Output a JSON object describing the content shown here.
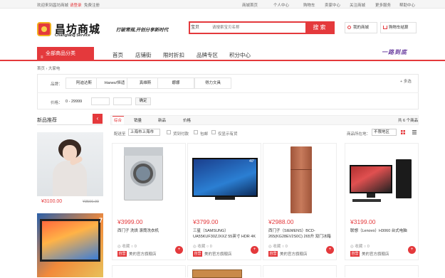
{
  "topbar": {
    "welcome": "欢迎来到昌坊商城",
    "login": "请登录",
    "register": "免费注册",
    "links": [
      "商城首页",
      "个人中心",
      "购物车",
      "卖家中心",
      "关注商城",
      "更多服务",
      "帮助中心"
    ]
  },
  "header": {
    "logo_cn": "昌坊商城",
    "logo_en": "Changfang Service",
    "slogan": "打破常规,开创分享新时代",
    "search_category": "宝贝",
    "search_placeholder": "请搜索宝贝名称",
    "search_button": "搜索",
    "my_mall": "我的商城",
    "cart": "购物车结算"
  },
  "nav": {
    "all_categories": "全部商品分类",
    "items": [
      "首页",
      "店铺街",
      "限时折扣",
      "品牌专区",
      "积分中心"
    ],
    "promo": "一路到底"
  },
  "breadcrumb": "首页 › 大家电",
  "filter": {
    "brand_label": "品牌：",
    "brands": [
      "阿迪达斯",
      "Hanes/恒适",
      "真维斯",
      "娜娜",
      "得力文具"
    ],
    "more": "多选",
    "price_label": "价格：",
    "price_range": "0 - 29999",
    "price_ok": "确定"
  },
  "sidebar": {
    "title": "新品推荐",
    "arrow": "‹",
    "price": "¥3100.00",
    "old_price": "¥3500.00",
    "label2": "7"
  },
  "sort": {
    "items": [
      "综合",
      "销量",
      "新品",
      "价格"
    ],
    "total": "共 6 个商品"
  },
  "options": {
    "ship_label": "配送至",
    "ship_value": "上海市上海市",
    "checks": [
      "货到付款",
      "包邮",
      "仅显示有货"
    ],
    "location_label": "商品所在地：",
    "location_value": "不限地区"
  },
  "products": [
    {
      "price": "¥3999.00",
      "name": "西门子 洗烘 滚筒洗衣机",
      "meta": "◎ 收藏   ○ 0",
      "self": "自营",
      "shop": "美的官方旗舰店",
      "cart": "+"
    },
    {
      "price": "¥3799.00",
      "name": "三星（SAMSUNG）UA55KUF30ZJXXZ 55英寸 HDR 4K超",
      "meta": "◎ 收藏   ○ 0",
      "self": "自营",
      "shop": "美的官方旗舰店",
      "cart": "+"
    },
    {
      "price": "¥2988.00",
      "name": "西门子（SIEMENS）BCD-265(KG28EV2S0C) 265升 双门冰箱",
      "meta": "◎ 收藏   ○ 0",
      "self": "自营",
      "shop": "美的官方旗舰店",
      "cart": "+"
    },
    {
      "price": "¥3199.00",
      "name": "联想（Lenovo）H3060 台式电脑",
      "meta": "◎ 收藏   ○ 0",
      "self": "自营",
      "shop": "美的官方旗舰店",
      "cart": "+"
    }
  ],
  "colors": {
    "accent": "#e4393c",
    "promo": "#6b3fa0"
  }
}
